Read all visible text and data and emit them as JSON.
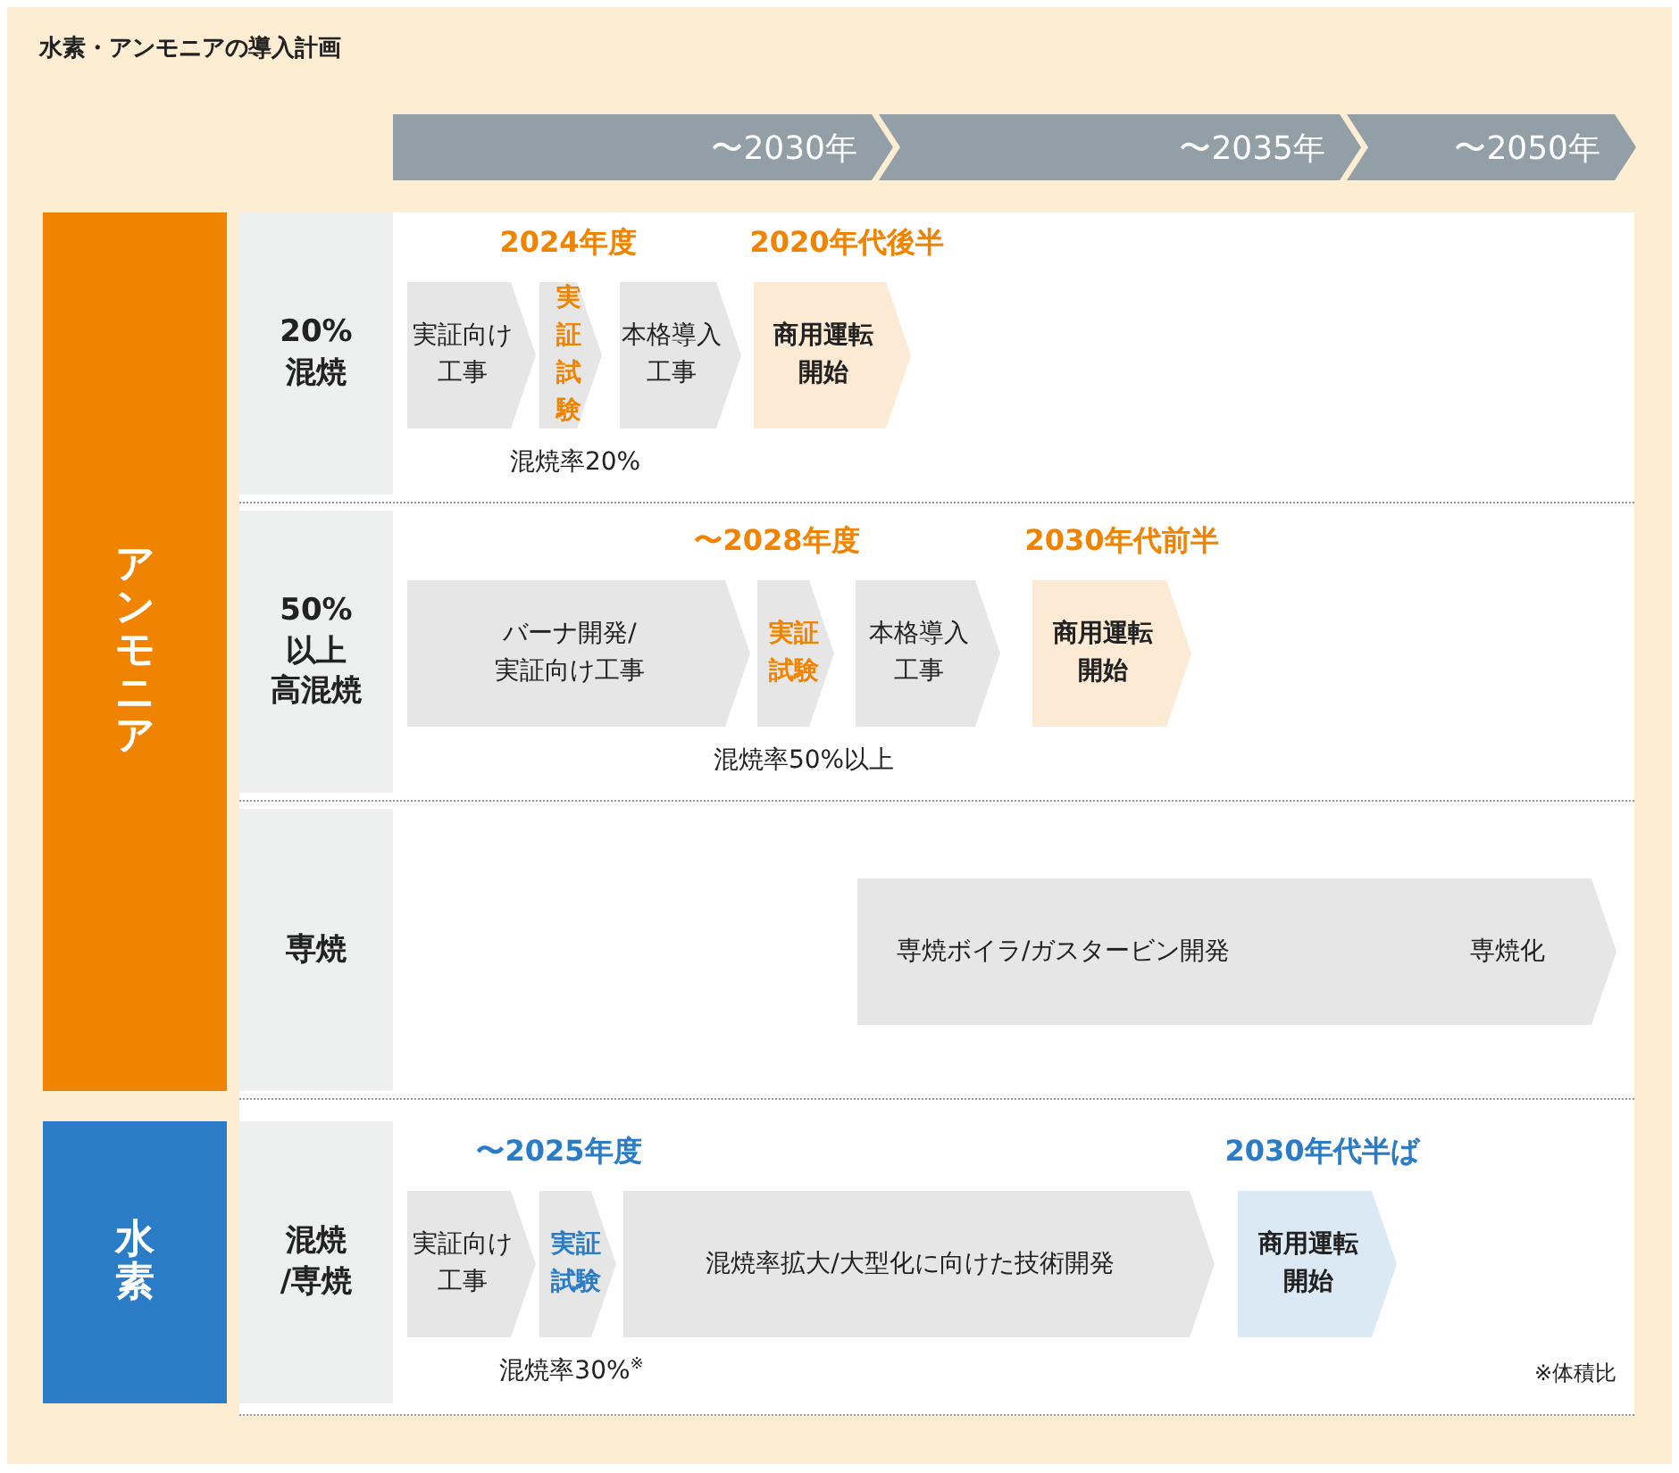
{
  "title": "水素・アンモニアの導入計画",
  "periods": [
    "〜2030年",
    "〜2035年",
    "〜2050年"
  ],
  "categories": [
    {
      "name": "アンモニア",
      "color": "#f08300",
      "lanes": [
        {
          "label_lines": [
            "20%",
            "混焼"
          ],
          "milestones": [
            "2024年度",
            "2020年代後半"
          ],
          "steps": [
            {
              "kind": "work",
              "labels": [
                "実証向け工事"
              ]
            },
            {
              "kind": "test",
              "labels": [
                "実証試験"
              ]
            },
            {
              "kind": "work",
              "labels": [
                "本格導入工事"
              ]
            },
            {
              "kind": "milestone",
              "labels": [
                "商用運転開始"
              ]
            }
          ],
          "note": "混焼率20%"
        },
        {
          "label_lines": [
            "50%",
            "以上",
            "高混焼"
          ],
          "milestones": [
            "〜2028年度",
            "2030年代前半"
          ],
          "steps": [
            {
              "kind": "work",
              "labels": [
                "バーナ開発/実証向け工事"
              ]
            },
            {
              "kind": "test",
              "labels": [
                "実証試験"
              ]
            },
            {
              "kind": "work",
              "labels": [
                "本格導入工事"
              ]
            },
            {
              "kind": "milestone",
              "labels": [
                "商用運転開始"
              ]
            }
          ],
          "note": "混焼率50%以上"
        },
        {
          "label_lines": [
            "専焼"
          ],
          "steps": [
            {
              "kind": "work",
              "labels": [
                "専焼ボイラ/ガスタービン開発",
                "専焼化"
              ]
            }
          ]
        }
      ]
    },
    {
      "name": "水素",
      "color": "#2a7cc7",
      "lanes": [
        {
          "label_lines": [
            "混焼",
            "/専焼"
          ],
          "milestones": [
            "〜2025年度",
            "2030年代半ば"
          ],
          "steps": [
            {
              "kind": "work",
              "labels": [
                "実証向け工事"
              ]
            },
            {
              "kind": "test",
              "labels": [
                "実証試験"
              ]
            },
            {
              "kind": "work",
              "labels": [
                "混焼率拡大/大型化に向けた技術開発"
              ]
            },
            {
              "kind": "milestone",
              "labels": [
                "商用運転開始"
              ]
            }
          ],
          "note": "混焼率30%$^{※}$",
          "footnote": "※体積比"
        }
      ]
    }
  ]
}
